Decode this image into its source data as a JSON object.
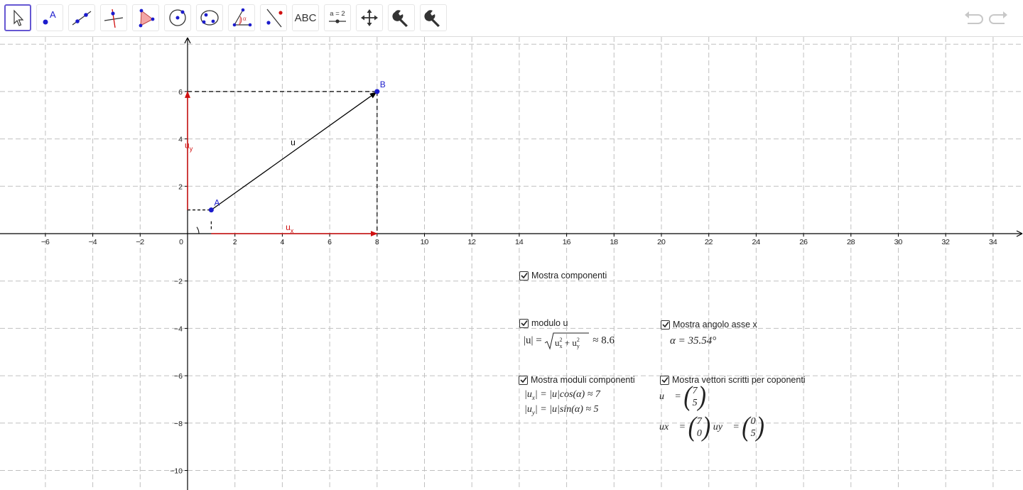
{
  "toolbar": {
    "tools": [
      {
        "id": "move",
        "icon": "cursor-arrow-icon"
      },
      {
        "id": "point",
        "icon": "point-icon",
        "label": "A"
      },
      {
        "id": "line",
        "icon": "line-through-points-icon"
      },
      {
        "id": "perpendicular",
        "icon": "perpendicular-line-icon"
      },
      {
        "id": "polygon",
        "icon": "polygon-icon"
      },
      {
        "id": "circle",
        "icon": "circle-center-point-icon"
      },
      {
        "id": "conic",
        "icon": "ellipse-icon"
      },
      {
        "id": "angle",
        "icon": "angle-icon",
        "label": "α"
      },
      {
        "id": "reflect",
        "icon": "reflect-line-icon"
      },
      {
        "id": "text",
        "icon": "text-icon",
        "label": "ABC"
      },
      {
        "id": "slider",
        "icon": "slider-icon",
        "label": "a = 2"
      },
      {
        "id": "move_view",
        "icon": "move-graphics-view-icon"
      },
      {
        "id": "tool1",
        "icon": "wrench-icon"
      },
      {
        "id": "tool2",
        "icon": "wrench-icon"
      }
    ],
    "undo_icon": "undo-icon",
    "redo_icon": "redo-icon"
  },
  "graph": {
    "x_ticks": [
      "−6",
      "−4",
      "−2",
      "0",
      "2",
      "4",
      "6",
      "8",
      "10",
      "12",
      "14",
      "16",
      "18",
      "20",
      "22",
      "24",
      "26",
      "28",
      "30",
      "32",
      "34"
    ],
    "x_tick_values": [
      -6,
      -4,
      -2,
      0,
      2,
      4,
      6,
      8,
      10,
      12,
      14,
      16,
      18,
      20,
      22,
      24,
      26,
      28,
      30,
      32,
      34
    ],
    "y_ticks": [
      "6",
      "4",
      "2",
      "−2",
      "−4",
      "−6",
      "−8",
      "−10"
    ],
    "y_tick_values": [
      6,
      4,
      2,
      -2,
      -4,
      -6,
      -8,
      -10
    ],
    "points": [
      {
        "name": "A",
        "x": 1,
        "y": 1
      },
      {
        "name": "B",
        "x": 8,
        "y": 6
      }
    ],
    "vector_label": "u",
    "ux_label": "u",
    "ux_sub": "x",
    "uy_label": "u",
    "uy_sub": "y",
    "colors": {
      "axis": "#000000",
      "grid": "#c0c0c0",
      "point": "#1c1ccc",
      "component": "#d01010",
      "vector": "#000000"
    }
  },
  "panel": {
    "show_components": {
      "label": "Mostra componenti",
      "checked": true
    },
    "modulo": {
      "label": "modulo u",
      "checked": true,
      "formula_lhs": "|u| =",
      "formula_rhs": "≈ 8.6"
    },
    "angle": {
      "label": "Mostra angolo asse x",
      "checked": true,
      "value": "α = 35.54°"
    },
    "moduli_componenti": {
      "label": "Mostra moduli componenti",
      "checked": true,
      "line1": "|u",
      "line1b": "| = |u|cos(α) ≈ 7",
      "line2": "|u",
      "line2b": "| = |u|sin(α) ≈ 5",
      "sub1": "x",
      "sub2": "y"
    },
    "vettori": {
      "label": "Mostra vettori scritti per coponenti",
      "checked": true,
      "u_lhs": "u⃗ =",
      "u_col": [
        "7",
        "5"
      ],
      "ux_lhs": "ux⃗ =",
      "ux_col": [
        "7",
        "0"
      ],
      "uy_lhs": "uy⃗ =",
      "uy_col": [
        "0",
        "5"
      ]
    }
  }
}
